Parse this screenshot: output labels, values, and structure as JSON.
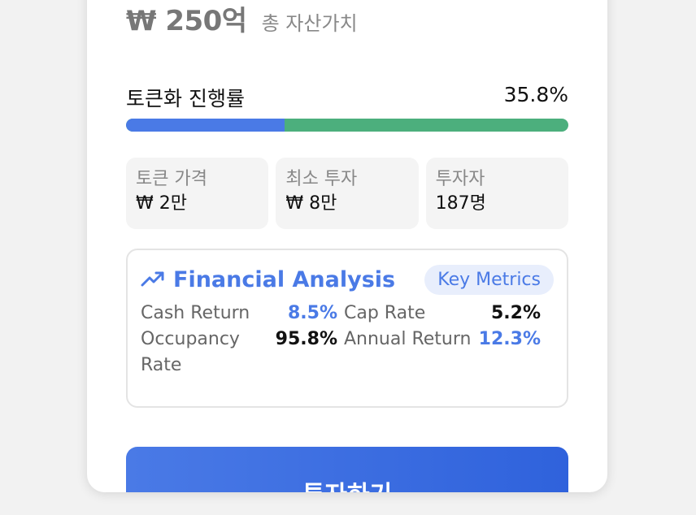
{
  "asset": {
    "price": "₩ 250억",
    "price_label": "총 자산가치"
  },
  "progress": {
    "label": "토큰화 진행률",
    "value_text": "35.8%",
    "fraction": 0.358
  },
  "stats": [
    {
      "label": "토큰 가격",
      "value": "₩ 2만"
    },
    {
      "label": "최소 투자",
      "value": "₩ 8만"
    },
    {
      "label": "투자자",
      "value": "187명"
    }
  ],
  "financial": {
    "icon": "trending-up-icon",
    "title": "Financial Analysis",
    "badge": "Key Metrics",
    "metrics": [
      {
        "label": "Cash Return",
        "value": "8.5%",
        "color": "#4a7ae6"
      },
      {
        "label": "Cap Rate",
        "value": "5.2%",
        "color": "#111111"
      },
      {
        "label": "Occupancy Rate",
        "value": "95.8%",
        "color": "#111111"
      },
      {
        "label": "Annual Return",
        "value": "12.3%",
        "color": "#4a7ae6"
      }
    ]
  },
  "cta": {
    "label": "투자하기"
  },
  "colors": {
    "accent": "#4a7ae6",
    "progress_remaining": "#4caf7d"
  }
}
